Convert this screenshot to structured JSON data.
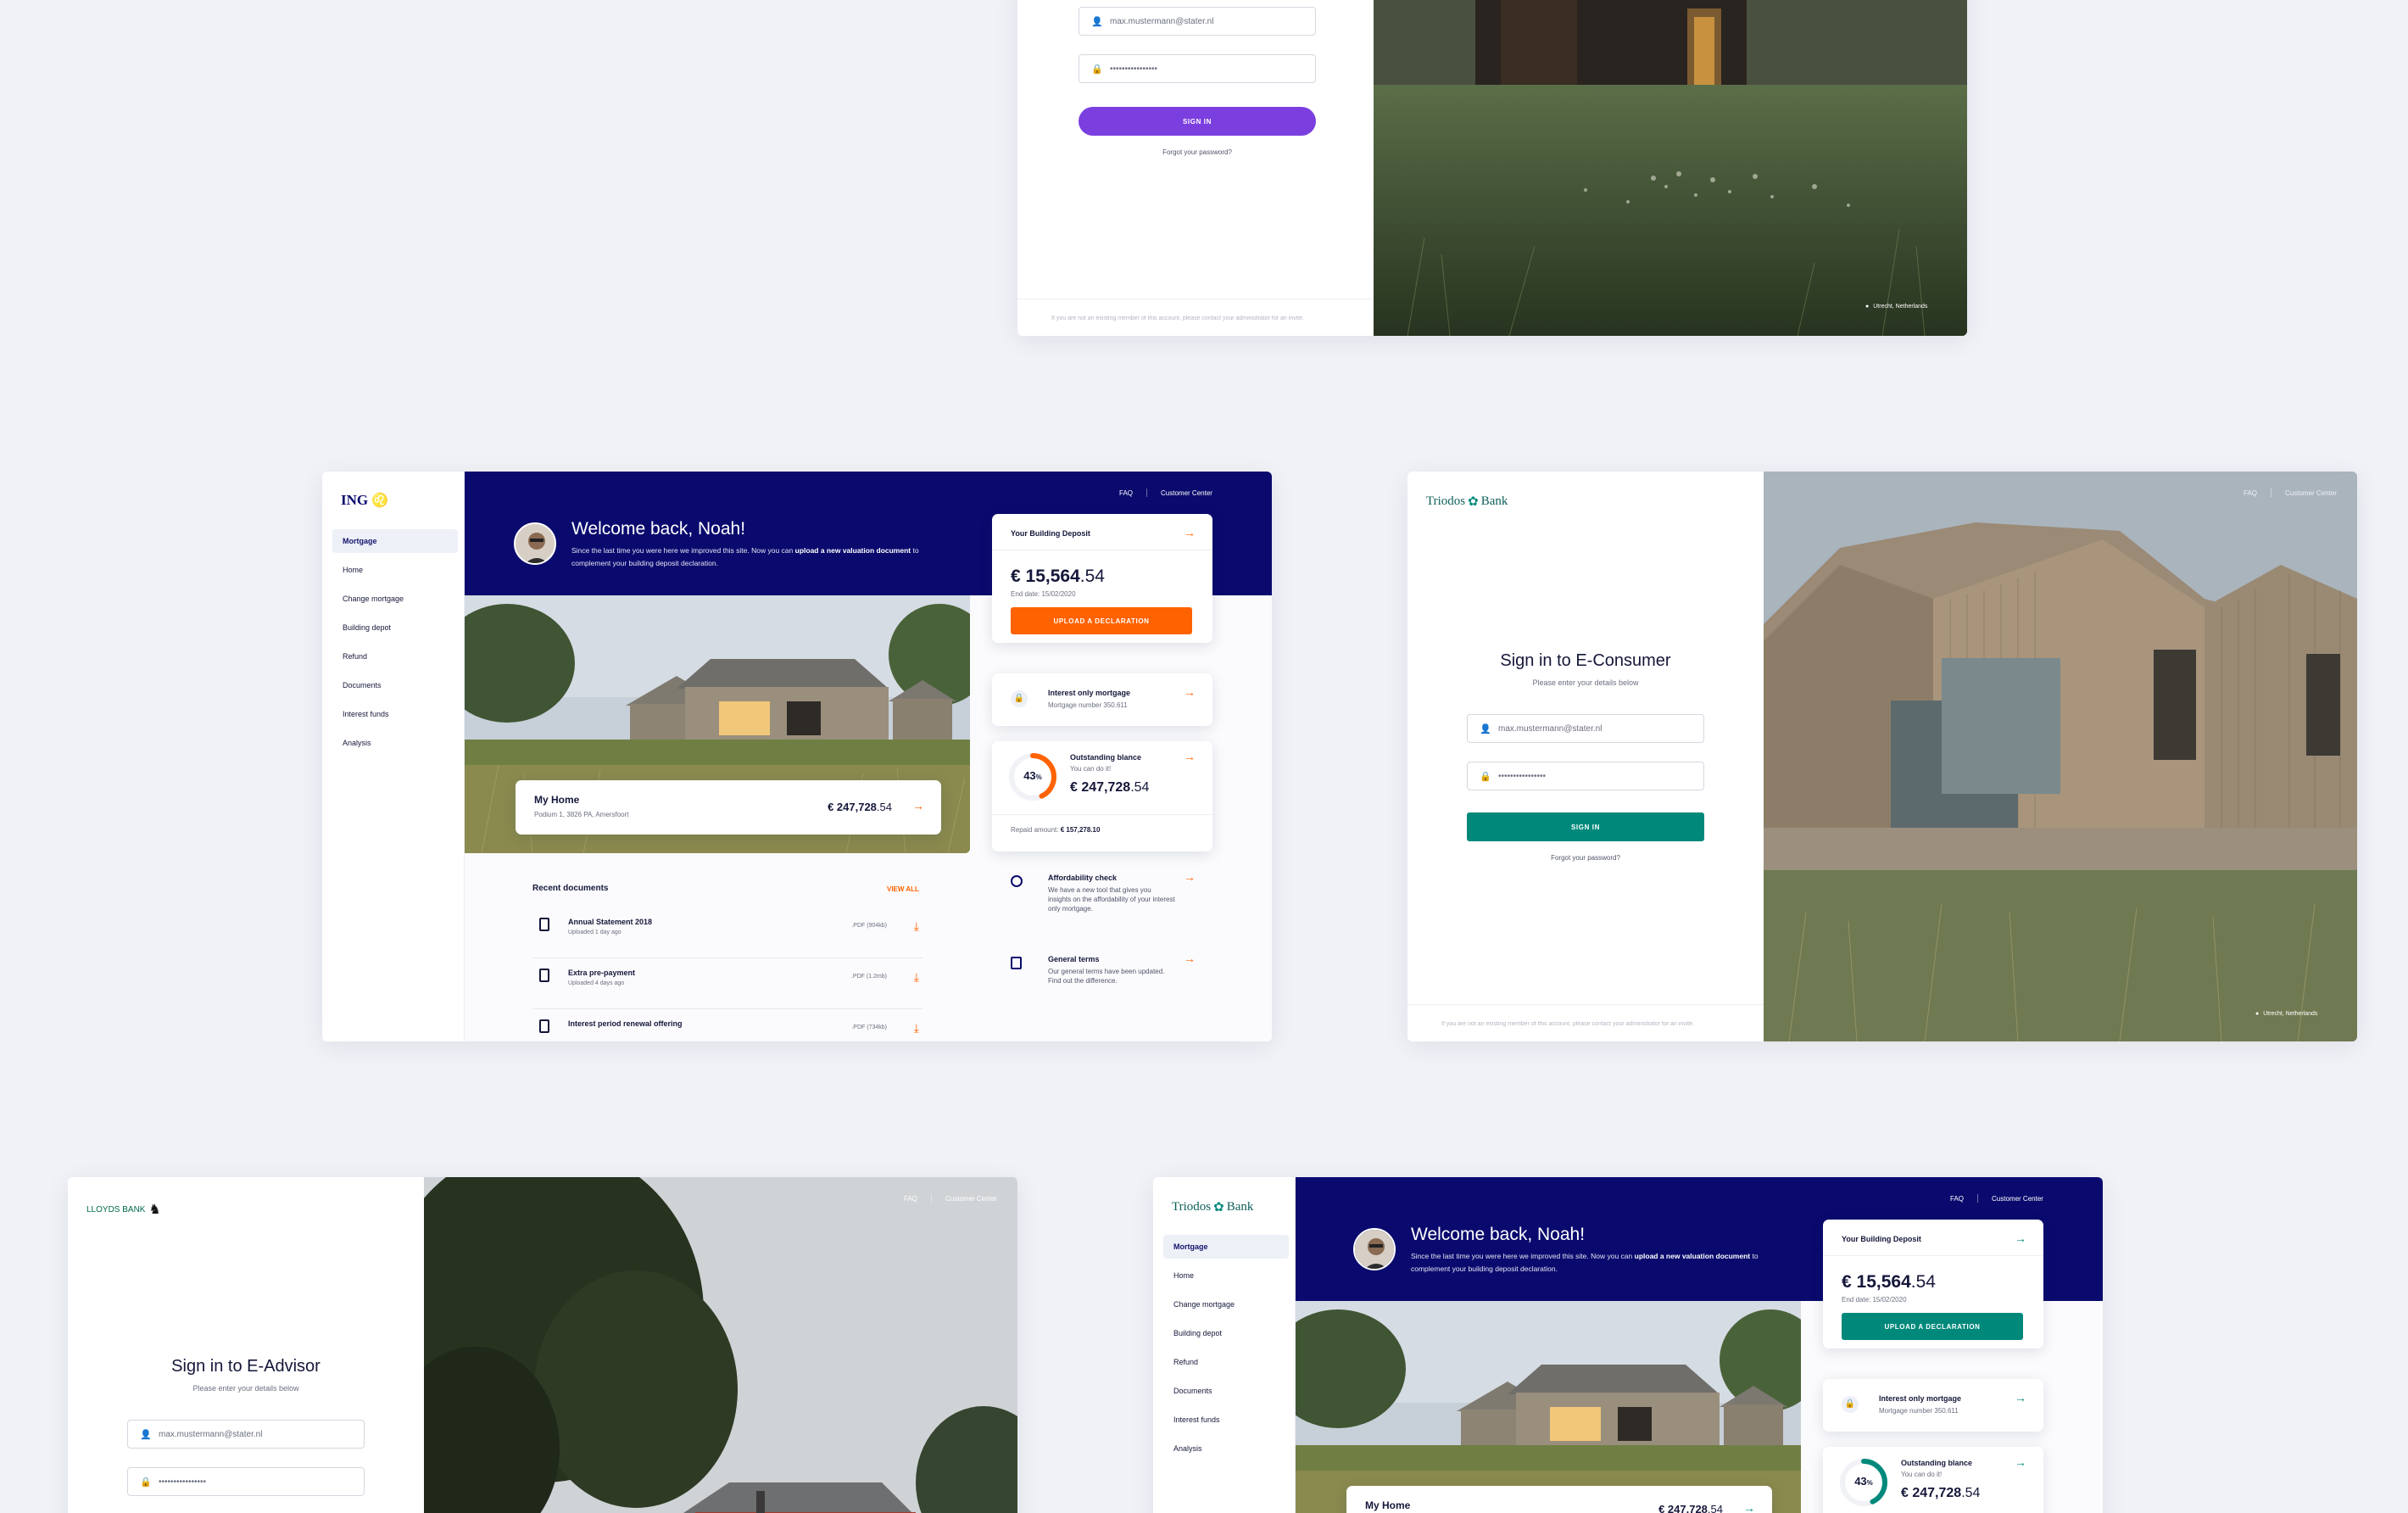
{
  "common": {
    "faq": "FAQ",
    "customer_center": "Customer Center",
    "email_value": "max.mustermann@stater.nl",
    "password_value": "••••••••••••••••",
    "sign_in": "SIGN IN",
    "forgot_password": "Forgot your password?",
    "please_enter": "Please enter your details below",
    "footer_note": "If you are not an existing member of this account, please contact your administrator for an invite.",
    "location": "Utrecht, Netherlands"
  },
  "colors": {
    "purple": "#7b3fe0",
    "ing_navy": "#0a0a6e",
    "ing_orange": "#ff6200",
    "triodos_green": "#00897b",
    "lloyds_green": "#006a4d",
    "background": "#f0f2f7"
  },
  "brands": {
    "ing": "ING",
    "triodos": "Triodos",
    "triodos_bank": "Bank",
    "lloyds": "LLOYDS BANK"
  },
  "login_ec": {
    "title": "Sign in to E-Consumer"
  },
  "login_ea": {
    "title": "Sign in to E-Advisor"
  },
  "dashboard": {
    "welcome": "Welcome back, Noah!",
    "intro_1": "Since the last time you were here we improved this site. Now you can ",
    "intro_bold": "upload a new valuation document",
    "intro_2": " to complement your building deposit declaration.",
    "sidebar": [
      "Mortgage",
      "Home",
      "Change mortgage",
      "Building depot",
      "Refund",
      "Documents",
      "Interest funds",
      "Analysis"
    ],
    "home_card": {
      "title": "My Home",
      "address": "Podium 1, 3826 PA, Amersfoort",
      "amount_main": "€ 247,728",
      "amount_dec": ".54"
    },
    "deposit": {
      "title": "Your Building Deposit",
      "amount_main": "€ 15,564",
      "amount_dec": ".54",
      "end_date": "End date: 15/02/2020",
      "button": "UPLOAD A DECLARATION"
    },
    "interest_only": {
      "title": "Interest only mortgage",
      "sub": "Mortgage number 350.611"
    },
    "outstanding": {
      "title": "Outstanding blance",
      "sub": "You can do it!",
      "percent": 43,
      "percent_label": "43",
      "percent_sign": "%",
      "amount_main": "€ 247,728",
      "amount_dec": ".54",
      "repaid_label": "Repaid amount:",
      "repaid_value": "€ 157,278.10"
    },
    "affordability": {
      "title": "Affordability check",
      "text": "We have a new tool that gives you insights on the affordability of your interest only mortgage."
    },
    "general_terms": {
      "title": "General terms",
      "text": "Our general terms have been updated. Find out the difference."
    },
    "recent_docs": {
      "title": "Recent documents",
      "view_all": "VIEW ALL",
      "items": [
        {
          "name": "Annual Statement 2018",
          "date": "Uploaded 1 day ago",
          "ext": ".PDF",
          "size": "(904kb)"
        },
        {
          "name": "Extra pre-payment",
          "date": "Uploaded 4 days ago",
          "ext": ".PDF",
          "size": "(1.2mb)"
        },
        {
          "name": "Interest period renewal offering",
          "date": "",
          "ext": ".PDF",
          "size": "(734kb)"
        }
      ]
    }
  }
}
